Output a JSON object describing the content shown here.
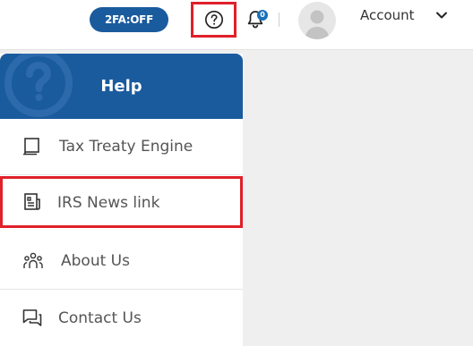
{
  "topbar": {
    "twofa_label": "2FA:OFF",
    "notifications_count": "0",
    "account_label": "Account"
  },
  "help_menu": {
    "title": "Help",
    "items": [
      {
        "label": "Tax Treaty Engine",
        "icon": "notebook-icon"
      },
      {
        "label": "IRS News link",
        "icon": "newspaper-icon"
      },
      {
        "label": "About Us",
        "icon": "people-icon"
      },
      {
        "label": "Contact Us",
        "icon": "chat-icon"
      }
    ]
  },
  "colors": {
    "brand_blue": "#1a5b9e",
    "highlight_red": "#e0202a"
  }
}
